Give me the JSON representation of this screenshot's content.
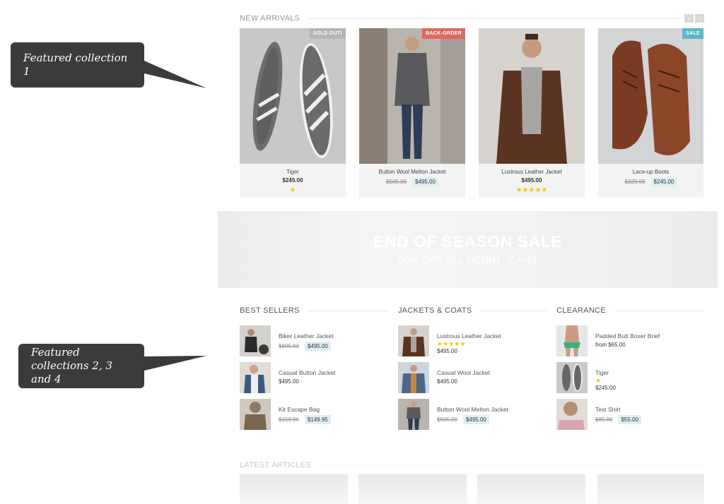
{
  "callouts": {
    "first": "Featured collection 1",
    "second": "Featured collections 2, 3 and 4"
  },
  "new_arrivals": {
    "title": "NEW ARRIVALS",
    "products": [
      {
        "name": "Tiger",
        "price": "$245.00",
        "badge": "SOLD OUT!",
        "rating": 1
      },
      {
        "name": "Button Wool Melton Jacket",
        "old_price": "$505.00",
        "price": "$495.00",
        "badge": "BACK-ORDER"
      },
      {
        "name": "Lustrous Leather Jacket",
        "price": "$495.00",
        "rating": 5
      },
      {
        "name": "Lace-up Boots",
        "old_price": "$329.00",
        "price": "$245.00",
        "badge": "SALE"
      }
    ]
  },
  "banner": {
    "title": "END OF SEASON SALE",
    "subtitle": "50% OFF ALL DENIM JEANS"
  },
  "best_sellers": {
    "title": "BEST SELLERS",
    "items": [
      {
        "name": "Biker Leather Jacket",
        "old_price": "$695.00",
        "price": "$495.00"
      },
      {
        "name": "Casual Button Jacket",
        "price": "$495.00"
      },
      {
        "name": "Kit Escape Bag",
        "old_price": "$159.95",
        "price": "$149.95"
      }
    ]
  },
  "jackets_coats": {
    "title": "JACKETS & COATS",
    "items": [
      {
        "name": "Lustrous Leather Jacket",
        "price": "$495.00",
        "rating": 5
      },
      {
        "name": "Casual Wool Jacket",
        "price": "$495.00"
      },
      {
        "name": "Button Wool Melton Jacket",
        "old_price": "$505.00",
        "price": "$495.00"
      }
    ]
  },
  "clearance": {
    "title": "CLEARANCE",
    "items": [
      {
        "name": "Padded Butt Boxer Brief",
        "price": "from $65.00"
      },
      {
        "name": "Tiger",
        "price": "$245.00",
        "rating": 1
      },
      {
        "name": "Test Shirt",
        "old_price": "$85.00",
        "price": "$55.00"
      }
    ]
  },
  "latest_articles": {
    "title": "LATEST ARTICLES"
  },
  "icons": {
    "prev": "chevron-left-icon",
    "next": "chevron-right-icon",
    "star": "star-icon"
  },
  "colors": {
    "sold_out_badge": "#b5b5b5",
    "back_order_badge": "#e0695f",
    "sale_badge": "#5ab8c9",
    "star": "#f3c900",
    "sale_price_bg": "#dfeef3"
  }
}
